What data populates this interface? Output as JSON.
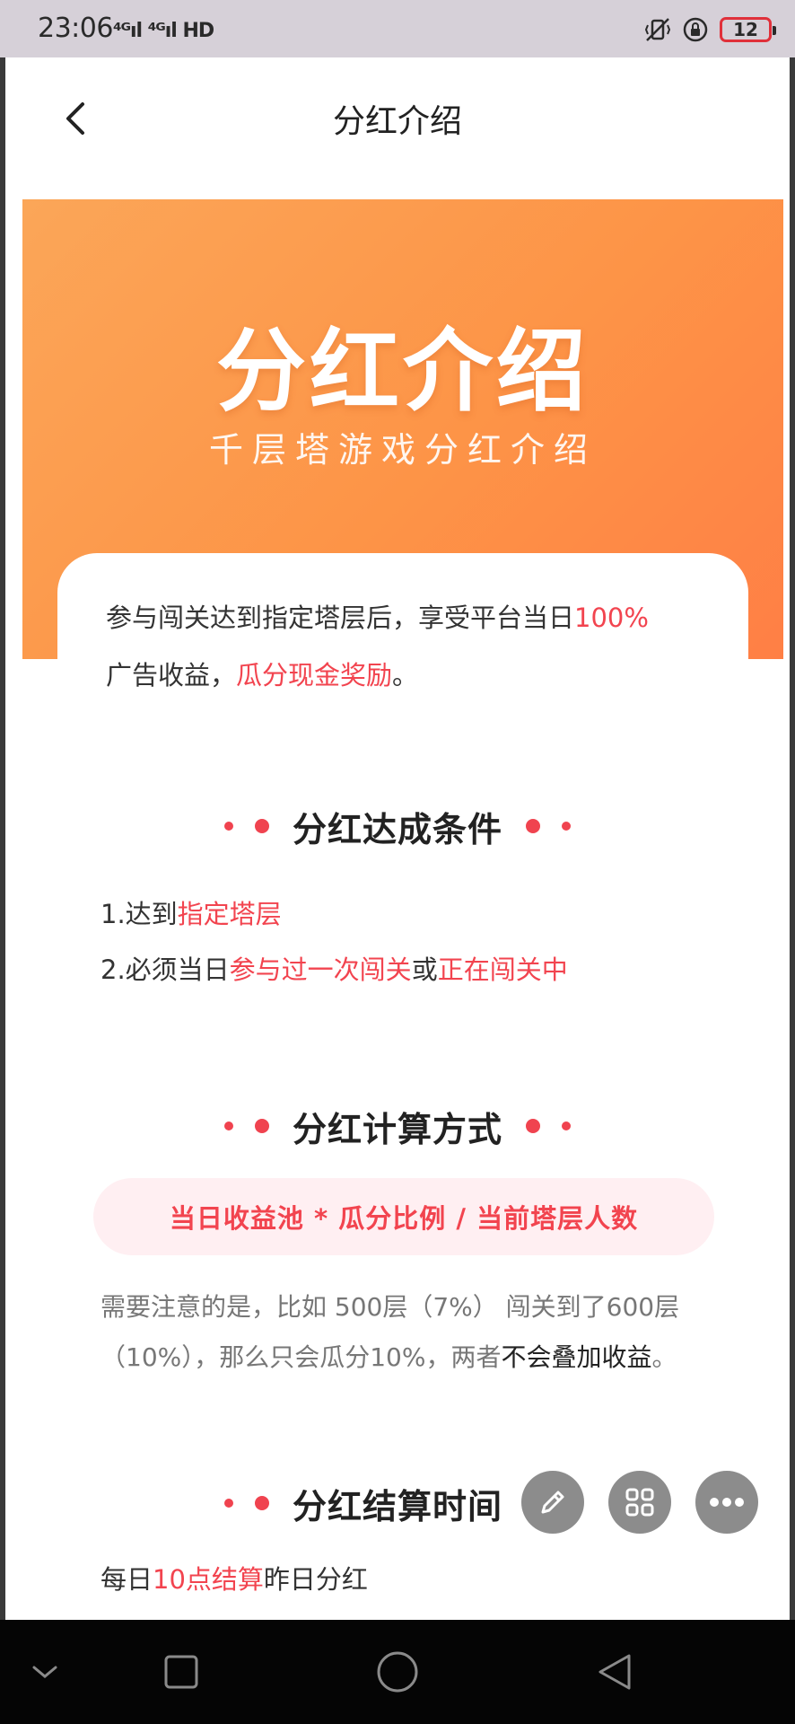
{
  "status_bar": {
    "time": "23:06",
    "signal_text": "⁴ᴳıl ⁴ᴳıl HD",
    "battery_level": "12"
  },
  "header": {
    "title": "分红介绍"
  },
  "hero": {
    "title": "分红介绍",
    "subtitle": "千层塔游戏分红介绍"
  },
  "intro": {
    "part1": "参与闯关达到指定塔层后，享受平台当日",
    "highlight1": "100%",
    "part2": "广告收益，",
    "highlight2": "瓜分现金奖励",
    "part3": "。"
  },
  "conditions": {
    "title": "分红达成条件",
    "item1_prefix": "1.达到",
    "item1_highlight": "指定塔层",
    "item2_prefix": "2.必须当日",
    "item2_highlight1": "参与过一次闯关",
    "item2_mid": "或",
    "item2_highlight2": "正在闯关中"
  },
  "calculation": {
    "title": "分红计算方式",
    "formula": "当日收益池 * 瓜分比例 / 当前塔层人数",
    "note_part1": "需要注意的是，比如 500层（7%） 闯关到了600层（10%），那么只会瓜分10%，两者",
    "note_emphasis": "不会叠加收益",
    "note_end": "。"
  },
  "settlement": {
    "title": "分红结算时间",
    "prefix": "每日",
    "highlight": "10点结算",
    "suffix": "昨日分红"
  },
  "colors": {
    "accent": "#f2444f",
    "hero_start": "#fba658",
    "hero_end": "#ff7f45",
    "formula_bg": "#ffeff2"
  },
  "icons": [
    "back-arrow-icon",
    "pencil-icon",
    "grid-icon",
    "more-icon",
    "chevron-down-icon",
    "square-icon",
    "circle-icon",
    "triangle-back-icon"
  ]
}
